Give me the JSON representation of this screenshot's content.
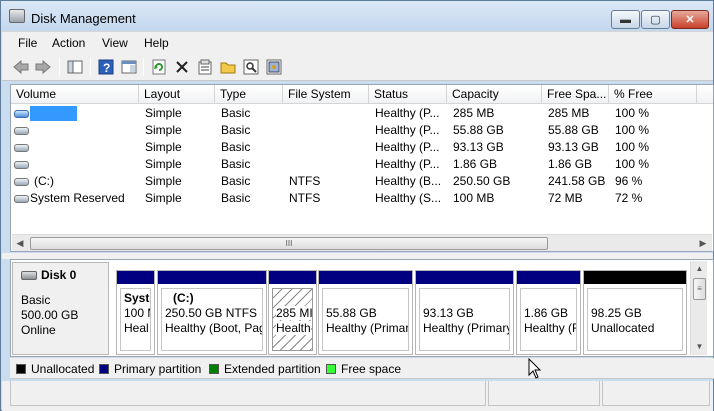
{
  "window": {
    "title": "Disk Management"
  },
  "titlebar_buttons": {
    "minimize": "▬",
    "maximize": "▢",
    "close": "✕"
  },
  "menu": [
    "File",
    "Action",
    "View",
    "Help"
  ],
  "toolbar_icons": [
    "back-icon",
    "forward-icon",
    "show-hide-console-tree-icon",
    "help-icon",
    "properties-pane-icon",
    "refresh-icon",
    "delete-icon",
    "properties-icon",
    "open-icon",
    "search-icon",
    "export-icon"
  ],
  "columns": [
    "Volume",
    "Layout",
    "Type",
    "File System",
    "Status",
    "Capacity",
    "Free Spa...",
    "% Free"
  ],
  "volumes": [
    {
      "volume": "",
      "layout": "Simple",
      "type": "Basic",
      "fs": "",
      "status": "Healthy (P...",
      "capacity": "285 MB",
      "free": "285 MB",
      "pct": "100 %",
      "selected": true
    },
    {
      "volume": "",
      "layout": "Simple",
      "type": "Basic",
      "fs": "",
      "status": "Healthy (P...",
      "capacity": "55.88 GB",
      "free": "55.88 GB",
      "pct": "100 %"
    },
    {
      "volume": "",
      "layout": "Simple",
      "type": "Basic",
      "fs": "",
      "status": "Healthy (P...",
      "capacity": "93.13 GB",
      "free": "93.13 GB",
      "pct": "100 %"
    },
    {
      "volume": "",
      "layout": "Simple",
      "type": "Basic",
      "fs": "",
      "status": "Healthy (P...",
      "capacity": "1.86 GB",
      "free": "1.86 GB",
      "pct": "100 %"
    },
    {
      "volume": "(C:)",
      "layout": "Simple",
      "type": "Basic",
      "fs": "NTFS",
      "status": "Healthy (B...",
      "capacity": "250.50 GB",
      "free": "241.58 GB",
      "pct": "96 %"
    },
    {
      "volume": "System Reserved",
      "layout": "Simple",
      "type": "Basic",
      "fs": "NTFS",
      "status": "Healthy (S...",
      "capacity": "100 MB",
      "free": "72 MB",
      "pct": "72 %"
    }
  ],
  "hscroll_grip": "III",
  "disk": {
    "name": "Disk 0",
    "type": "Basic",
    "size": "500.00 GB",
    "status": "Online"
  },
  "partitions": [
    {
      "l1": "Syste",
      "l2": "100 M",
      "l3": "Heal",
      "bar": "#000080"
    },
    {
      "l1": "(C:)",
      "l2": "250.50 GB NTFS",
      "l3": "Healthy (Boot, Pag",
      "bar": "#000080"
    },
    {
      "l1": "",
      "l2": "285 MI",
      "l3": "Health",
      "bar": "#000080",
      "selected": true
    },
    {
      "l1": "",
      "l2": "55.88 GB",
      "l3": "Healthy (Primar",
      "bar": "#000080"
    },
    {
      "l1": "",
      "l2": "93.13 GB",
      "l3": "Healthy (Primary",
      "bar": "#000080"
    },
    {
      "l1": "",
      "l2": "1.86 GB",
      "l3": "Healthy (F",
      "bar": "#000080"
    },
    {
      "l1": "",
      "l2": "98.25 GB",
      "l3": "Unallocated",
      "bar": "#000000"
    }
  ],
  "legend": [
    {
      "label": "Unallocated",
      "color": "#000000"
    },
    {
      "label": "Primary partition",
      "color": "#000080"
    },
    {
      "label": "Extended partition",
      "color": "#008000"
    },
    {
      "label": "Free space",
      "color": "#33ff33"
    }
  ]
}
